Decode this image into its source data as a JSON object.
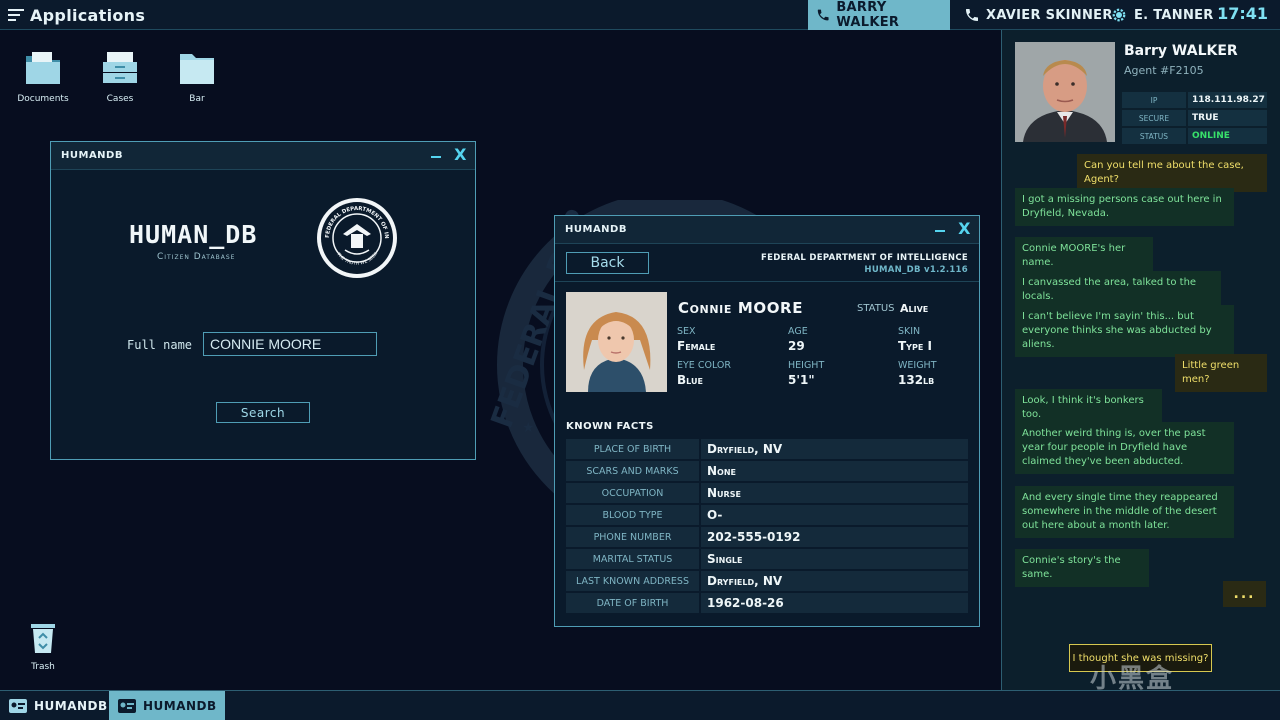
{
  "topbar": {
    "apps_label": "Applications",
    "contacts": [
      {
        "name": "BARRY WALKER",
        "icon": "phone-icon",
        "active": true
      },
      {
        "name": "XAVIER SKINNER",
        "icon": "phone-icon",
        "active": false
      },
      {
        "name": "E. TANNER",
        "icon": "gear-icon",
        "active": false
      }
    ],
    "clock": "17:41"
  },
  "desktop": {
    "icons": [
      {
        "label": "Documents",
        "icon": "documents-folder-icon"
      },
      {
        "label": "Cases",
        "icon": "cases-drawer-icon"
      },
      {
        "label": "Bar",
        "icon": "folder-icon"
      },
      {
        "label": "Trash",
        "icon": "trash-icon"
      }
    ]
  },
  "search_window": {
    "title": "HUMANDB",
    "app_name": "HUMAN_DB",
    "app_subtitle": "Citizen Database",
    "seal_top_text": "FEDERAL DEPARTMENT OF INTELLIGENCE",
    "seal_bottom_text": "THE TRUTH WE SEEK",
    "full_name_label": "Full name",
    "full_name_value": "CONNIE MOORE",
    "search_label": "Search"
  },
  "record_window": {
    "title": "HUMANDB",
    "back_label": "Back",
    "agency": "FEDERAL DEPARTMENT OF INTELLIGENCE",
    "version": "HUMAN_DB   v1.2.116",
    "person": {
      "first_name": "Connie",
      "last_name": "MOORE",
      "status_label": "STATUS",
      "status_value": "Alive",
      "attributes": [
        {
          "key": "SEX",
          "value": "Female"
        },
        {
          "key": "AGE",
          "value": "29"
        },
        {
          "key": "SKIN",
          "value": "Type I"
        },
        {
          "key": "EYE COLOR",
          "value": "Blue"
        },
        {
          "key": "HEIGHT",
          "value": "5'1\""
        },
        {
          "key": "WEIGHT",
          "value": "132lb"
        }
      ]
    },
    "known_facts_heading": "KNOWN FACTS",
    "facts": [
      {
        "key": "PLACE OF BIRTH",
        "value": "Dryfield, NV"
      },
      {
        "key": "SCARS AND MARKS",
        "value": "None"
      },
      {
        "key": "OCCUPATION",
        "value": "Nurse"
      },
      {
        "key": "BLOOD TYPE",
        "value": "O-"
      },
      {
        "key": "PHONE NUMBER",
        "value": "202-555-0192"
      },
      {
        "key": "MARITAL STATUS",
        "value": "Single"
      },
      {
        "key": "LAST KNOWN ADDRESS",
        "value": "Dryfield, NV"
      },
      {
        "key": "DATE OF BIRTH",
        "value": "1962-08-26"
      }
    ]
  },
  "chat": {
    "agent_name": "Barry WALKER",
    "agent_id": "Agent #F2105",
    "info": [
      {
        "key": "IP",
        "value": "118.111.98.27"
      },
      {
        "key": "SECURE",
        "value": "TRUE"
      },
      {
        "key": "STATUS",
        "value": "ONLINE"
      }
    ],
    "messages": [
      {
        "from": "me",
        "text": "Can you tell me about the case, Agent?"
      },
      {
        "from": "agent",
        "text": "I got a missing persons case out here in Dryfield, Nevada."
      },
      {
        "from": "agent",
        "text": "Connie MOORE's her name."
      },
      {
        "from": "agent",
        "text": "I canvassed the area, talked to the locals."
      },
      {
        "from": "agent",
        "text": "I can't believe I'm sayin' this... but everyone thinks she was abducted by aliens."
      },
      {
        "from": "me",
        "text": "Little green men?"
      },
      {
        "from": "agent",
        "text": "Look, I think it's bonkers too."
      },
      {
        "from": "agent",
        "text": "Another weird thing is, over the past year four people in Dryfield have claimed they've been abducted."
      },
      {
        "from": "agent",
        "text": "And every single time they reappeared somewhere in the middle of the desert out here about a month later."
      },
      {
        "from": "agent",
        "text": "Connie's story's the same."
      }
    ],
    "typing": "...",
    "reply_option": "I thought she was missing?"
  },
  "taskbar": {
    "tasks": [
      {
        "label": "HUMANDB",
        "active": false
      },
      {
        "label": "HUMANDB",
        "active": true
      }
    ]
  },
  "watermark": "小黑盒",
  "colors": {
    "background": "#070d1f",
    "accent": "#55d4ef",
    "active_tab": "#6fb7c9",
    "agent_message": "#7fe39a",
    "player_message": "#f0df6a",
    "online": "#38e06a"
  }
}
